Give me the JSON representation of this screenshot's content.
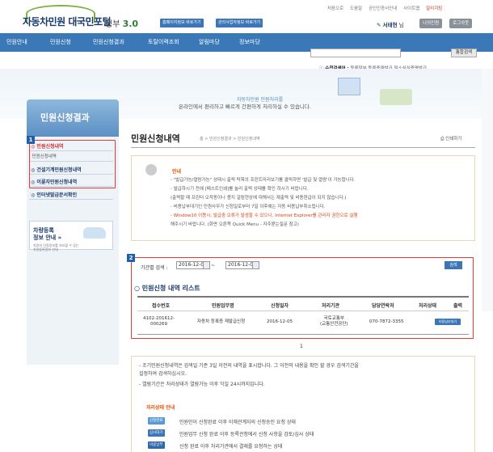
{
  "site": {
    "name": "자동차민원 대국민포털",
    "gov_prefix": "정부",
    "gov_num": "3.0",
    "btn_sub1": "홈페이지정보 바로가기",
    "btn_sub2": "관리사업자정보 바로가기"
  },
  "util_links": [
    "처음으로",
    "도움말",
    "공인인증서안내",
    "사이트맵",
    "알리지팅"
  ],
  "user": {
    "name": "서태현",
    "suffix": "님",
    "btn1": "나의민원",
    "btn2": "로그아웃"
  },
  "nav": [
    "민원안내",
    "민원신청",
    "민원신청결과",
    "토탈이력조회",
    "알림마당",
    "정보마당"
  ],
  "search_btn": "통합검색",
  "recent": {
    "label": "수천검색어 :",
    "items": "등록말부   등록증재발급   필소식실증명발급"
  },
  "banner": {
    "line1": "자동차민원 민원처리를",
    "line2": "온라인에서 편리하고 빠르게 간편하게 처리하실 수 있습니다."
  },
  "sidebar": {
    "title": "민원신청결과",
    "items": [
      "민원신청내역",
      "· 민원신청내역",
      "건설기계민원신청내역",
      "이륜자민원신청내역",
      "인터넷발급문서확인"
    ],
    "promo_title1": "차량등록",
    "promo_title2": "정보 안내",
    "promo_text1": "차량의 민원정보를 처리할 수 있는",
    "promo_text2": "차량등록정보 안내"
  },
  "main": {
    "title": "민원신청내역",
    "breadcrumb": "홈 > 민원신청결과 > 민원신청내역",
    "print": "인쇄하기"
  },
  "notice": {
    "heading": "안내",
    "l1": "- \"발급가능/열람가능\" 상태시 출력 탁목의 프린트미리보기를 클릭하면 '발급 및 열람'이 가능합니다.",
    "l2": "- 발급하시기 전에 [페스트인쇄]를 눌러 출력 상태를 확인 하시기 바랍니다.",
    "l3": "  (출력할 때 프린터 오작동이나 용지 걸림현상에 대해서는 재출력 및 비용환급이 되지 않습니다.)",
    "l4": "- 비용납부대기인 민원사무가 신청일로부터 7일 이후에는 자동 비용납부취소됩니다.",
    "l5": "- Window10 이용시, 발급중 오류가 발생할 수 있으니, Internet Explorer를 관리자 권한으로 실행",
    "l6": "  해주시기 바랍니다. (화면 오른쪽 Quick Menu - 자주묻는질문 참고)"
  },
  "filter": {
    "label": "기간별 검색 :",
    "start": "2016-12-03",
    "end": "2016-12-06",
    "search": "검색"
  },
  "list": {
    "title": "민원신청 내역 리스트",
    "headers": [
      "접수번호",
      "민원업무명",
      "신청일자",
      "처리기관",
      "담당연락처",
      "처리상태",
      "출력"
    ],
    "row": {
      "no1": "4102-201612-",
      "no2": "000269",
      "task": "자동차 등록증 재발급신청",
      "date": "2016-12-05",
      "org1": "국토교통부",
      "org2": "(교통안전공단)",
      "phone": "070-7872-3355",
      "status": "비용납부대기"
    }
  },
  "page": "1",
  "info": {
    "l1": "- 조기민원신청내역은 검색일 기준 3일 이전의 내역을 표시합니다. 그 이전의 내용을 확인 할 경우 검색기간을",
    "l1b": "  설정하여 검색하십시오.",
    "l2": "- 열람기간은 처리상태가 열람가능 이후 익일 24시까지입니다.",
    "status_title": "처리상태 안내",
    "s1": "신청완료",
    "s1t": "민원인이 신청완료 이후 이해관계자의 신청승인 요청 상태",
    "s2": "심사대기",
    "s2t": "민원업무 신청 완료 이후 등록관청에서 신청 사항을 검토/심사 상태",
    "s3": "비용납부",
    "s3t": "신청 완료 이후 처리기관에서 결제를 요청하는 상태"
  },
  "tags": {
    "t1": "1",
    "t2": "2"
  },
  "colors": {
    "nav": "#3a78b7",
    "red_box": "#e53935",
    "accent_orange": "#e65100"
  }
}
